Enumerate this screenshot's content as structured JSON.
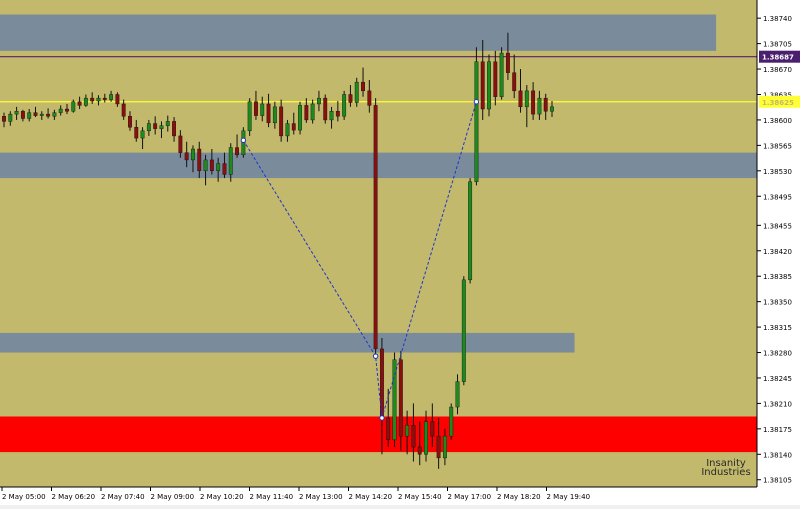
{
  "chart_data": {
    "type": "candlestick",
    "symbol_hidden": true,
    "colors": {
      "background": "#c2b96c",
      "bull_body": "#1c8a1c",
      "bear_body": "#8a0f0f",
      "wick": "#111111",
      "zone_blue": "#7a8c9c",
      "zone_red": "#ff0000",
      "hline_purple": "#5a1f6e",
      "hline_yellow": "#ffff33",
      "dotted_line": "#2233cc"
    },
    "y_axis": {
      "min": 1.38095,
      "max": 1.38765,
      "ticks": [
        "1.38740",
        "1.38705",
        "1.38670",
        "1.38635",
        "1.38600",
        "1.38565",
        "1.38530",
        "1.38495",
        "1.38455",
        "1.38420",
        "1.38385",
        "1.38350",
        "1.38315",
        "1.38280",
        "1.38245",
        "1.38210",
        "1.38175",
        "1.38140",
        "1.38105"
      ],
      "badges": [
        {
          "label": "1.38687",
          "value": 1.38687,
          "bg": "#4a1f6e",
          "fg": "#ffffff"
        },
        {
          "label": "1.38625",
          "value": 1.38625,
          "bg": "#ffff33",
          "fg": "#c2b96c"
        }
      ]
    },
    "x_axis": {
      "ticks": [
        "2 May 05:00",
        "2 May 06:20",
        "2 May 07:40",
        "2 May 09:00",
        "2 May 10:20",
        "2 May 11:40",
        "2 May 13:00",
        "2 May 14:20",
        "2 May 15:40",
        "2 May 17:00",
        "2 May 18:20",
        "2 May 19:40"
      ]
    },
    "zones": [
      {
        "color": "blue",
        "from": 1.38745,
        "to": 1.38695,
        "x_end_frac": 0.946
      },
      {
        "color": "blue",
        "from": 1.38555,
        "to": 1.3852,
        "x_end_frac": 1.0
      },
      {
        "color": "blue",
        "from": 1.38307,
        "to": 1.3828,
        "x_end_frac": 0.759
      },
      {
        "color": "red",
        "from": 1.38192,
        "to": 1.38143,
        "x_end_frac": 1.0
      }
    ],
    "hlines": [
      {
        "color": "purple",
        "value": 1.38687
      },
      {
        "color": "yellow",
        "value": 1.38625
      }
    ],
    "candles": [
      [
        1.38605,
        1.3861,
        1.3859,
        1.38598
      ],
      [
        1.38598,
        1.38612,
        1.38592,
        1.38608
      ],
      [
        1.38608,
        1.38618,
        1.386,
        1.38612
      ],
      [
        1.38612,
        1.38614,
        1.38598,
        1.38602
      ],
      [
        1.38602,
        1.38615,
        1.38598,
        1.3861
      ],
      [
        1.3861,
        1.38618,
        1.38604,
        1.38606
      ],
      [
        1.38606,
        1.38612,
        1.386,
        1.38608
      ],
      [
        1.38608,
        1.38616,
        1.38602,
        1.38605
      ],
      [
        1.38605,
        1.38614,
        1.386,
        1.3861
      ],
      [
        1.3861,
        1.3862,
        1.38606,
        1.38615
      ],
      [
        1.38615,
        1.38622,
        1.38608,
        1.38612
      ],
      [
        1.38612,
        1.38628,
        1.3861,
        1.38625
      ],
      [
        1.38625,
        1.38632,
        1.38615,
        1.3862
      ],
      [
        1.3862,
        1.38635,
        1.38618,
        1.3863
      ],
      [
        1.3863,
        1.38638,
        1.38622,
        1.38626
      ],
      [
        1.38626,
        1.38634,
        1.3862,
        1.3863
      ],
      [
        1.3863,
        1.38636,
        1.38624,
        1.38628
      ],
      [
        1.38628,
        1.3864,
        1.38625,
        1.38635
      ],
      [
        1.38635,
        1.38638,
        1.38618,
        1.38622
      ],
      [
        1.38622,
        1.38628,
        1.386,
        1.38605
      ],
      [
        1.38605,
        1.38612,
        1.38585,
        1.3859
      ],
      [
        1.3859,
        1.386,
        1.3857,
        1.38575
      ],
      [
        1.38575,
        1.3859,
        1.3856,
        1.38585
      ],
      [
        1.38585,
        1.386,
        1.38578,
        1.38595
      ],
      [
        1.38595,
        1.38605,
        1.3858,
        1.38588
      ],
      [
        1.38588,
        1.38598,
        1.38575,
        1.38592
      ],
      [
        1.38592,
        1.38606,
        1.38584,
        1.38598
      ],
      [
        1.38598,
        1.38604,
        1.3857,
        1.38578
      ],
      [
        1.38578,
        1.38586,
        1.38548,
        1.38555
      ],
      [
        1.38555,
        1.3857,
        1.38535,
        1.38545
      ],
      [
        1.38545,
        1.38565,
        1.38528,
        1.3856
      ],
      [
        1.3856,
        1.3857,
        1.3852,
        1.3853
      ],
      [
        1.3853,
        1.38552,
        1.3851,
        1.38545
      ],
      [
        1.38545,
        1.3856,
        1.38525,
        1.3853
      ],
      [
        1.3853,
        1.38548,
        1.38515,
        1.3854
      ],
      [
        1.3854,
        1.38555,
        1.3852,
        1.38525
      ],
      [
        1.38525,
        1.38568,
        1.38515,
        1.38562
      ],
      [
        1.38562,
        1.3858,
        1.38548,
        1.38552
      ],
      [
        1.38552,
        1.3859,
        1.38548,
        1.38585
      ],
      [
        1.38585,
        1.3863,
        1.38578,
        1.38625
      ],
      [
        1.38625,
        1.3864,
        1.386,
        1.38606
      ],
      [
        1.38606,
        1.38632,
        1.38598,
        1.38622
      ],
      [
        1.38622,
        1.38636,
        1.3859,
        1.38596
      ],
      [
        1.38596,
        1.38625,
        1.38588,
        1.38618
      ],
      [
        1.38618,
        1.38628,
        1.3857,
        1.38578
      ],
      [
        1.38578,
        1.386,
        1.3857,
        1.38595
      ],
      [
        1.38595,
        1.3861,
        1.3858,
        1.38586
      ],
      [
        1.38586,
        1.38625,
        1.3858,
        1.3862
      ],
      [
        1.3862,
        1.3863,
        1.38596,
        1.386
      ],
      [
        1.386,
        1.38628,
        1.38595,
        1.38622
      ],
      [
        1.38622,
        1.3864,
        1.38612,
        1.3863
      ],
      [
        1.3863,
        1.38635,
        1.38595,
        1.386
      ],
      [
        1.386,
        1.38618,
        1.38588,
        1.38612
      ],
      [
        1.38612,
        1.38626,
        1.38598,
        1.38605
      ],
      [
        1.38605,
        1.3864,
        1.386,
        1.38635
      ],
      [
        1.38635,
        1.38648,
        1.38618,
        1.38624
      ],
      [
        1.38624,
        1.38658,
        1.38618,
        1.38652
      ],
      [
        1.38652,
        1.38672,
        1.38632,
        1.3864
      ],
      [
        1.3864,
        1.38655,
        1.3861,
        1.3862
      ],
      [
        1.3862,
        1.3863,
        1.38278,
        1.38285
      ],
      [
        1.38285,
        1.383,
        1.3814,
        1.3819
      ],
      [
        1.3819,
        1.3823,
        1.3815,
        1.3816
      ],
      [
        1.3816,
        1.3828,
        1.3815,
        1.3827
      ],
      [
        1.3827,
        1.38282,
        1.38145,
        1.38165
      ],
      [
        1.38165,
        1.382,
        1.3814,
        1.3818
      ],
      [
        1.3818,
        1.3821,
        1.3813,
        1.3815
      ],
      [
        1.3815,
        1.38185,
        1.38125,
        1.3814
      ],
      [
        1.3814,
        1.382,
        1.3813,
        1.38185
      ],
      [
        1.38185,
        1.3821,
        1.3815,
        1.38165
      ],
      [
        1.38165,
        1.3819,
        1.3812,
        1.38135
      ],
      [
        1.38135,
        1.38175,
        1.38125,
        1.38165
      ],
      [
        1.38165,
        1.3821,
        1.3816,
        1.38205
      ],
      [
        1.38205,
        1.3825,
        1.38195,
        1.3824
      ],
      [
        1.3824,
        1.38385,
        1.38235,
        1.3838
      ],
      [
        1.3838,
        1.3852,
        1.38375,
        1.38515
      ],
      [
        1.38515,
        1.387,
        1.3851,
        1.3868
      ],
      [
        1.3868,
        1.3871,
        1.386,
        1.38615
      ],
      [
        1.38615,
        1.3869,
        1.38605,
        1.3868
      ],
      [
        1.3868,
        1.38695,
        1.3862,
        1.38632
      ],
      [
        1.38632,
        1.387,
        1.38628,
        1.38692
      ],
      [
        1.38692,
        1.3872,
        1.38655,
        1.38665
      ],
      [
        1.38665,
        1.3869,
        1.3863,
        1.3864
      ],
      [
        1.3864,
        1.3867,
        1.3861,
        1.38618
      ],
      [
        1.38618,
        1.38648,
        1.3859,
        1.3864
      ],
      [
        1.3864,
        1.38652,
        1.386,
        1.38608
      ],
      [
        1.38608,
        1.3864,
        1.386,
        1.3863
      ],
      [
        1.3863,
        1.38636,
        1.386,
        1.38612
      ],
      [
        1.38612,
        1.38626,
        1.38604,
        1.38618
      ]
    ],
    "dotted_path": [
      {
        "i": 38,
        "p": 1.38572
      },
      {
        "i": 59,
        "p": 1.38275
      },
      {
        "i": 60,
        "p": 1.3819
      },
      {
        "i": 75,
        "p": 1.38625
      }
    ],
    "watermark": [
      "Insanity",
      "Industries"
    ]
  }
}
